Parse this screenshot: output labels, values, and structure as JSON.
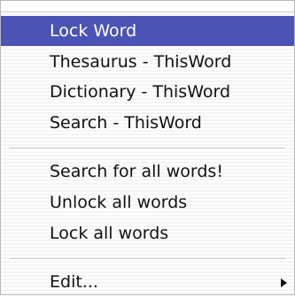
{
  "menu": {
    "items": [
      {
        "label": "Lock Word"
      },
      {
        "label": "Thesaurus - ThisWord"
      },
      {
        "label": "Dictionary - ThisWord"
      },
      {
        "label": "Search - ThisWord"
      },
      {
        "label": "Search for all words!"
      },
      {
        "label": "Unlock all words"
      },
      {
        "label": "Lock all words"
      },
      {
        "label": "Edit...",
        "icon": "chevron-right-icon"
      }
    ],
    "selected_item": "Lock Word",
    "colors": {
      "selection": "#4b53b5",
      "text": "#111111",
      "selected_text": "#ffffff"
    }
  }
}
